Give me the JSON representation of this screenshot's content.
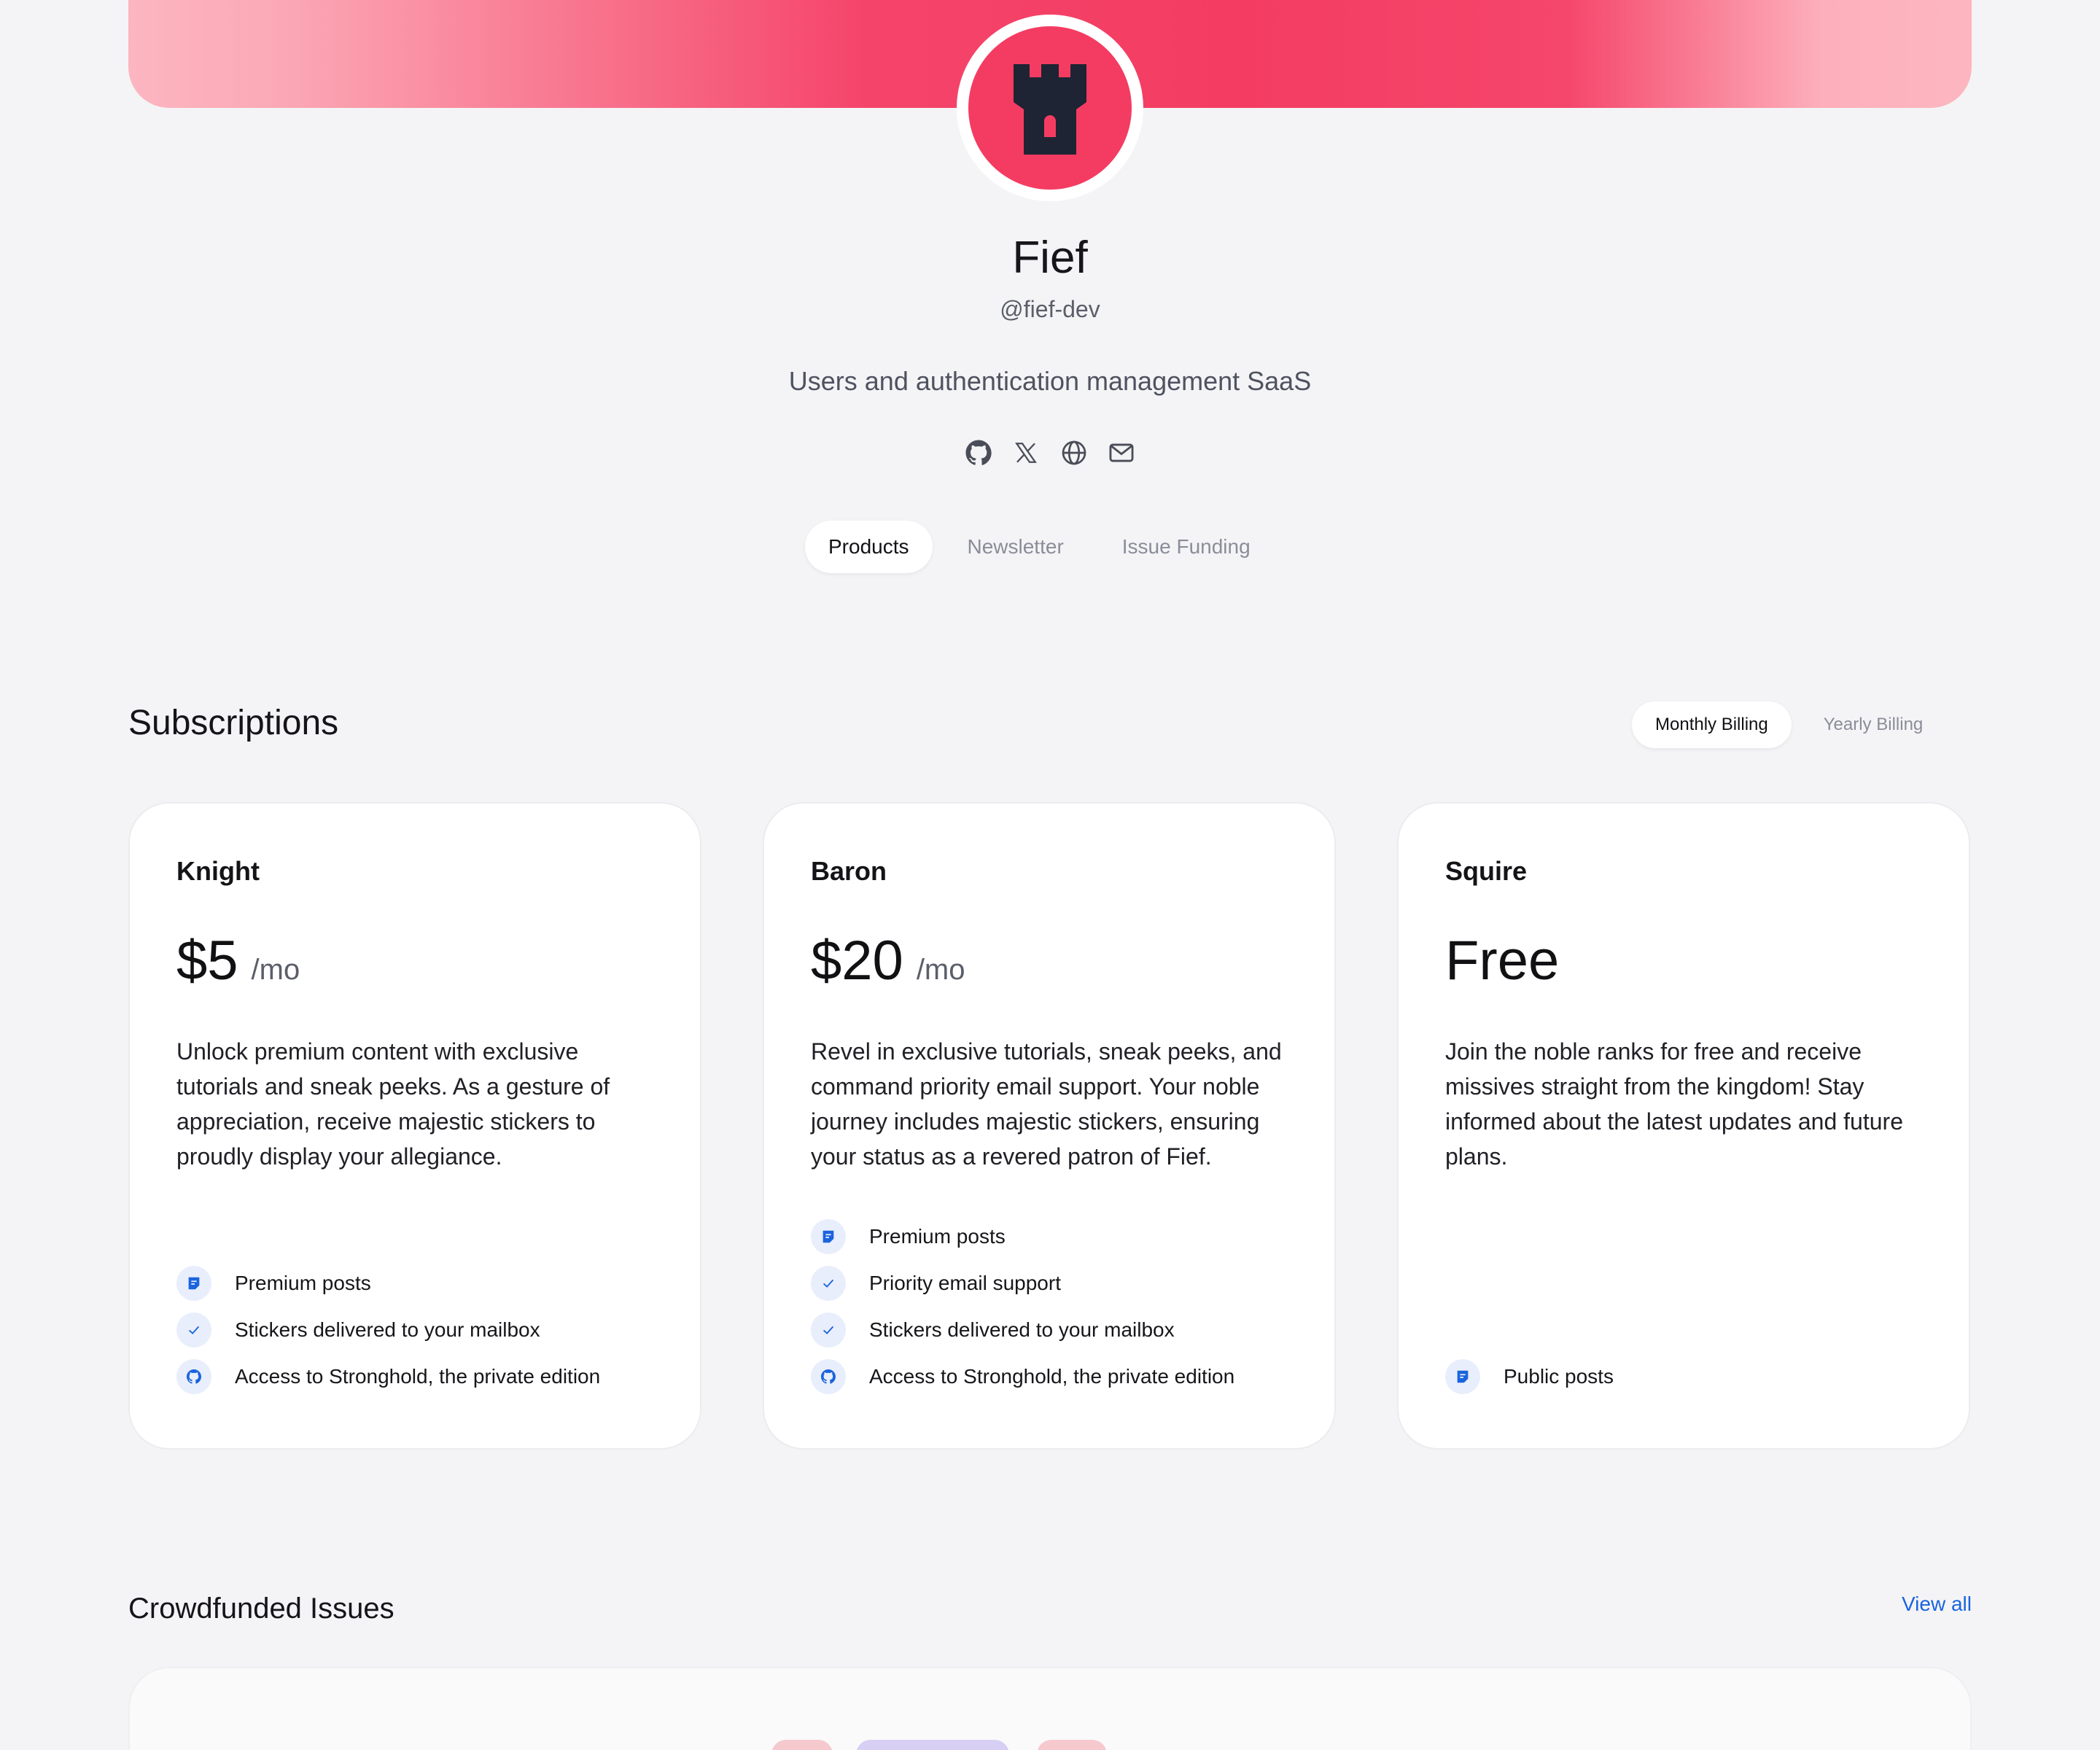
{
  "header": {
    "name": "Fief",
    "handle": "@fief-dev",
    "description": "Users and authentication management SaaS",
    "social_icons": [
      "github-icon",
      "x-icon",
      "globe-icon",
      "mail-icon"
    ]
  },
  "tabs": [
    {
      "label": "Products",
      "active": true
    },
    {
      "label": "Newsletter",
      "active": false
    },
    {
      "label": "Issue Funding",
      "active": false
    }
  ],
  "subscriptions": {
    "title": "Subscriptions",
    "billing": [
      {
        "label": "Monthly Billing",
        "active": true
      },
      {
        "label": "Yearly Billing",
        "active": false
      }
    ],
    "tiers": [
      {
        "name": "Knight",
        "price": "$5",
        "period": "/mo",
        "description": "Unlock premium content with exclusive tutorials and sneak peeks. As a gesture of appreciation, receive majestic stickers to proudly display your allegiance.",
        "features": [
          {
            "icon": "post-icon",
            "label": "Premium posts"
          },
          {
            "icon": "check-icon",
            "label": "Stickers delivered to your mailbox"
          },
          {
            "icon": "github-icon",
            "label": "Access to Stronghold, the private edition"
          }
        ]
      },
      {
        "name": "Baron",
        "price": "$20",
        "period": "/mo",
        "description": "Revel in exclusive tutorials, sneak peeks, and command priority email support. Your noble journey includes majestic stickers, ensuring your status as a revered patron of Fief.",
        "features": [
          {
            "icon": "post-icon",
            "label": "Premium posts"
          },
          {
            "icon": "check-icon",
            "label": "Priority email support"
          },
          {
            "icon": "check-icon",
            "label": "Stickers delivered to your mailbox"
          },
          {
            "icon": "github-icon",
            "label": "Access to Stronghold, the private edition"
          }
        ]
      },
      {
        "name": "Squire",
        "price": "Free",
        "period": "",
        "description": "Join the noble ranks for free and receive missives straight from the kingdom! Stay informed about the latest updates and future plans.",
        "features": [
          {
            "icon": "post-icon",
            "label": "Public posts"
          }
        ]
      }
    ]
  },
  "crowdfunded": {
    "title": "Crowdfunded Issues",
    "view_all": "View all"
  },
  "colors": {
    "brand": "#f43c62",
    "accent": "#1a64dd",
    "background": "#f4f4f6"
  }
}
